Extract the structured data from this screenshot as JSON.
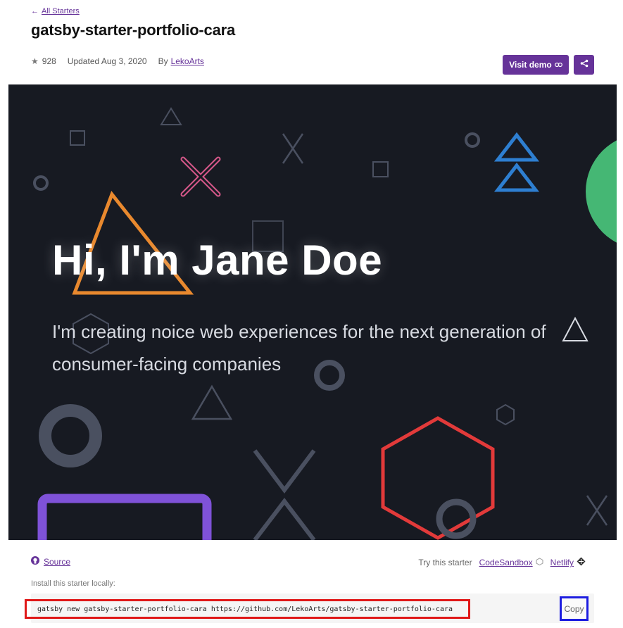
{
  "nav": {
    "back_label": "All Starters"
  },
  "header": {
    "title": "gatsby-starter-portfolio-cara",
    "stars": "928",
    "updated": "Updated Aug 3, 2020",
    "by_label": "By",
    "author": "LekoArts",
    "visit_demo_label": "Visit demo"
  },
  "preview": {
    "hero_title": "Hi, I'm Jane Doe",
    "hero_subtitle": "I'm creating noice web experiences for the next generation of consumer-facing companies",
    "colors": {
      "background": "#171a22",
      "orange": "#e9892e",
      "pink": "#d6588a",
      "blue": "#2e7fd1",
      "green": "#45b774",
      "red": "#e23a3a",
      "purple": "#7f52d8",
      "gray": "#4a5060"
    }
  },
  "footer": {
    "source_label": "Source",
    "try_label": "Try this starter",
    "codesandbox_label": "CodeSandbox",
    "netlify_label": "Netlify",
    "install_label": "Install this starter locally:",
    "install_command": "gatsby new gatsby-starter-portfolio-cara https://github.com/LekoArts/gatsby-starter-portfolio-cara",
    "copy_label": "Copy"
  },
  "colors": {
    "accent": "#663399"
  }
}
